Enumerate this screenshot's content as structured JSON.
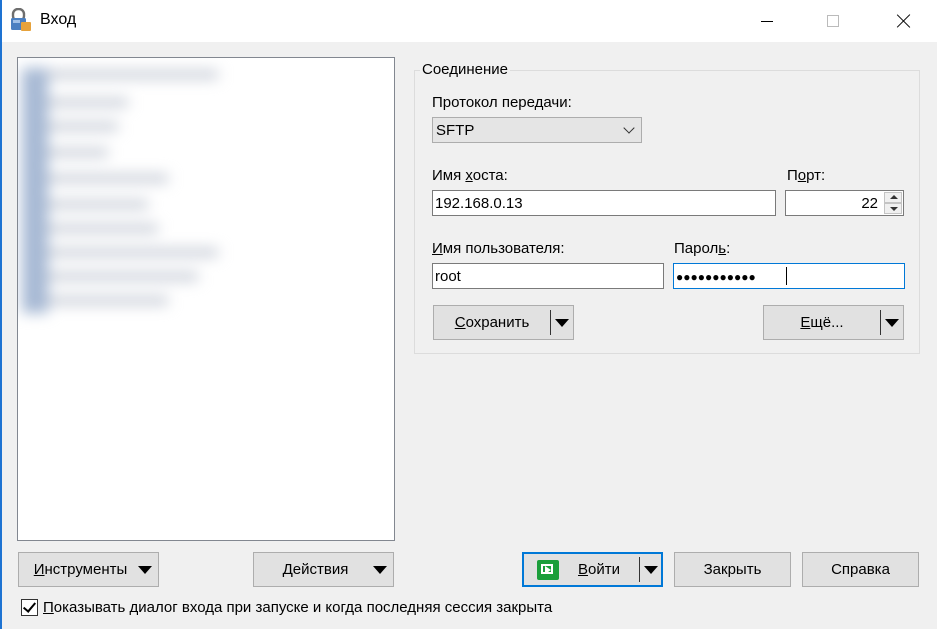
{
  "window": {
    "title": "Вход",
    "accent_color": "#0078d7",
    "icon": "winscp-lock-icon"
  },
  "connection": {
    "legend": "Соединение",
    "protocol_label": "Протокол передачи:",
    "protocol_value": "SFTP",
    "host_label_pre": "Имя ",
    "host_label_u": "х",
    "host_label_post": "оста:",
    "host_value": "192.168.0.13",
    "port_label_pre": "П",
    "port_label_u": "о",
    "port_label_post": "рт:",
    "port_value": "22",
    "user_label_pre": "",
    "user_label_u": "И",
    "user_label_post": "мя пользователя:",
    "password_label_pre": "Парол",
    "password_label_u": "ь",
    "password_label_post": ":",
    "user_value": "root",
    "password_value": "●●●●●●●●●●●"
  },
  "buttons": {
    "save_pre": "",
    "save_u": "С",
    "save_post": "охранить",
    "more_pre": "",
    "more_u": "Е",
    "more_post": "щё...",
    "tools_pre": "",
    "tools_u": "И",
    "tools_post": "нструменты",
    "actions_pre": "",
    "actions_u": "Д",
    "actions_post": "ействия",
    "login_pre": "",
    "login_u": "В",
    "login_post": "ойти",
    "close": "Закрыть",
    "help": "Справка"
  },
  "footer": {
    "show_dialog_checked": true,
    "show_dialog_pre": "",
    "show_dialog_u": "П",
    "show_dialog_post": "оказывать диалог входа при запуске и когда последняя сессия закрыта"
  }
}
